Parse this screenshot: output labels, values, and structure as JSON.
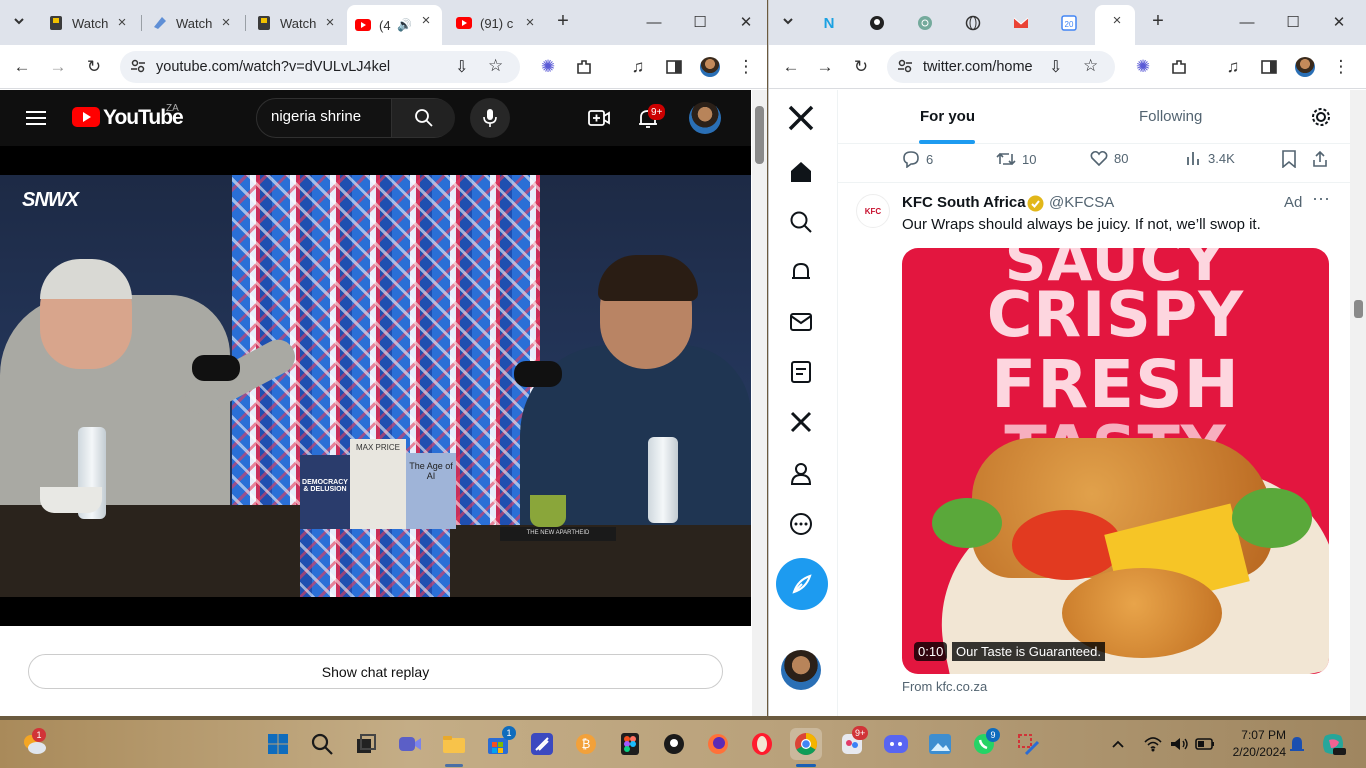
{
  "left_window": {
    "tabs": [
      {
        "title": "Watch",
        "active": false
      },
      {
        "title": "Watch",
        "active": false
      },
      {
        "title": "Watch",
        "active": false
      },
      {
        "title": "(4",
        "active": true
      },
      {
        "title": "(91) c",
        "active": false
      }
    ],
    "url": "youtube.com/watch?v=dVULvLJ4kel",
    "youtube": {
      "logo_text": "YouTube",
      "country": "ZA",
      "search_value": "nigeria shrine",
      "notification_badge": "9+",
      "video_overlay_logo": "SNWX",
      "book_titles": [
        "DEMOCRACY & DELUSION",
        "MAX PRICE",
        "The Age of AI",
        "THE NEW APARTHEID"
      ],
      "chat_replay_label": "Show chat replay"
    }
  },
  "right_window": {
    "url": "twitter.com/home",
    "tabs_header": {
      "for_you": "For you",
      "following": "Following"
    },
    "prev_tweet_actions": {
      "replies": "6",
      "retweets": "10",
      "likes": "80",
      "views": "3.4K"
    },
    "ad_tweet": {
      "author": "KFC South Africa",
      "handle": "@KFCSA",
      "ad_label": "Ad",
      "text": "Our Wraps should always be juicy. If not, we’ll swop it.",
      "image_words": [
        "SAUCY",
        "CRISPY",
        "FRESH",
        "TASTY"
      ],
      "video_time": "0:10",
      "caption": "Our Taste is Guaranteed.",
      "source": "From kfc.co.za",
      "logo_text": "KFC"
    }
  },
  "taskbar": {
    "weather_badge": "1",
    "store_badge": "1",
    "copilot_badge": "9+",
    "whatsapp_badge": "9",
    "time": "7:07 PM",
    "date": "2/20/2024"
  }
}
